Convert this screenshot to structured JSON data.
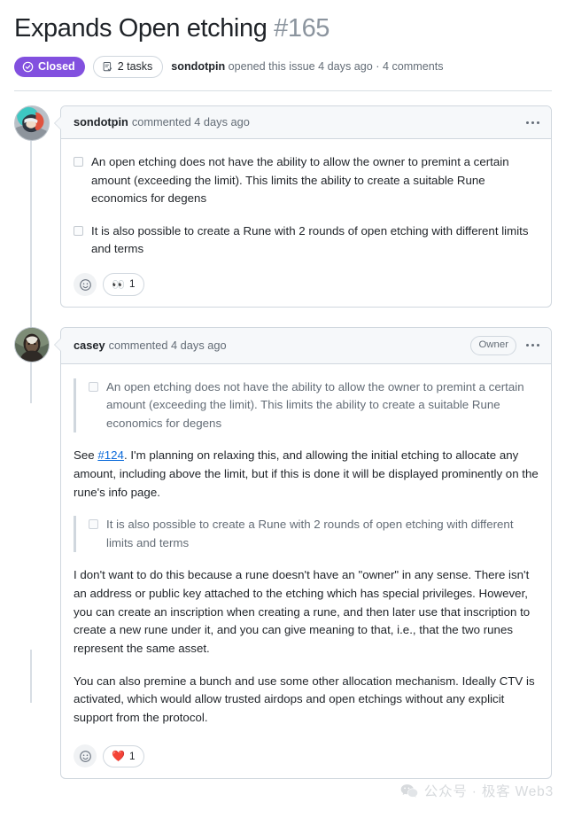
{
  "issue": {
    "title": "Expands Open etching",
    "number": "#165",
    "state_label": "Closed",
    "state_color": "#8250df",
    "tasks_label": "2 tasks",
    "meta_author": "sondotpin",
    "meta_text": " opened this issue 4 days ago · 4 comments"
  },
  "comments": [
    {
      "author": "sondotpin",
      "action": "commented 4 days ago",
      "owner_badge": null,
      "tasks": [
        "An open etching does not have the ability to allow the owner to premint a certain amount (exceeding the limit). This limits the ability to create a suitable Rune economics for degens",
        "It is also possible to create a Rune with 2 rounds of open etching with different limits and terms"
      ],
      "reaction": {
        "emoji": "👀",
        "count": "1"
      }
    },
    {
      "author": "casey",
      "action": "commented 4 days ago",
      "owner_badge": "Owner",
      "quote1": "An open etching does not have the ability to allow the owner to premint a certain amount (exceeding the limit). This limits the ability to create a suitable Rune economics for degens",
      "para1_prefix": "See ",
      "para1_link": "#124",
      "para1_rest": ". I'm planning on relaxing this, and allowing the initial etching to allocate any amount, including above the limit, but if this is done it will be displayed prominently on the rune's info page.",
      "quote2": "It is also possible to create a Rune with 2 rounds of open etching with different limits and terms",
      "para2": "I don't want to do this because a rune doesn't have an \"owner\" in any sense. There isn't an address or public key attached to the etching which has special privileges. However, you can create an inscription when creating a rune, and then later use that inscription to create a new rune under it, and you can give meaning to that, i.e., that the two runes represent the same asset.",
      "para3": "You can also premine a bunch and use some other allocation mechanism. Ideally CTV is activated, which would allow trusted airdops and open etchings without any explicit support from the protocol.",
      "reaction": {
        "emoji": "❤️",
        "count": "1"
      }
    }
  ],
  "watermark": {
    "text": "公众号 · 极客 Web3",
    "icon": "wechat-icon"
  }
}
